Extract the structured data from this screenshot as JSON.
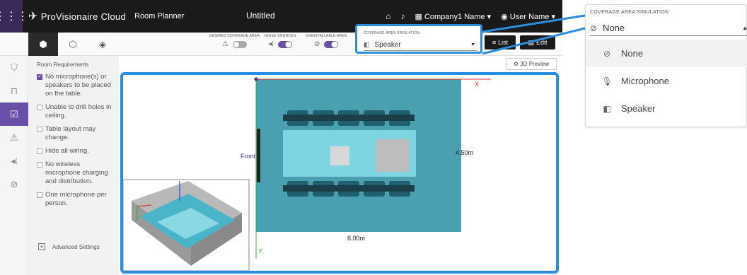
{
  "header": {
    "brand": "ProVisionaire Cloud",
    "app": "Room Planner",
    "doc_title": "Untitled",
    "company": "Company1 Name",
    "user": "User Name"
  },
  "toolbar": {
    "view_tabs": [
      "top-view",
      "3d-view",
      "object-view"
    ],
    "toggles": [
      {
        "label": "DESIRED COVERAGE AREA",
        "state": "off"
      },
      {
        "label": "NOISE SOURCES",
        "state": "on"
      },
      {
        "label": "UNINSTALLABLE AREA",
        "state": "on"
      }
    ],
    "coverage": {
      "label": "COVERAGE AREA SIMULATION",
      "value": "Speaker"
    },
    "list_label": "List",
    "edit_label": "Edit",
    "preview_label": "3D Preview"
  },
  "requirements": {
    "title": "Room Requirements",
    "items": [
      {
        "text": "No microphone(s) or speakers to be placed on the table.",
        "checked": true
      },
      {
        "text": "Unable to drill holes in ceiling.",
        "checked": false
      },
      {
        "text": "Table layout may change.",
        "checked": false
      },
      {
        "text": "Hide all wiring.",
        "checked": false
      },
      {
        "text": "No wireless microphone charging and distribution.",
        "checked": false
      },
      {
        "text": "One microphone per person.",
        "checked": false
      }
    ],
    "advanced": "Advanced Settings"
  },
  "plan": {
    "front_label": "Front",
    "width_label": "6.00m",
    "depth_label": "4.50m",
    "x_axis": "X",
    "y_axis": "Y",
    "colors": {
      "room": "#4a9fb0",
      "table": "#7fd4e2",
      "chair": "#1f5f6e"
    }
  },
  "dropdown": {
    "label": "COVERAGE AREA SIMULATION",
    "selected": "None",
    "options": [
      "None",
      "Microphone",
      "Speaker"
    ]
  },
  "accent": "#2a8de0",
  "purple": "#6a4fa8"
}
